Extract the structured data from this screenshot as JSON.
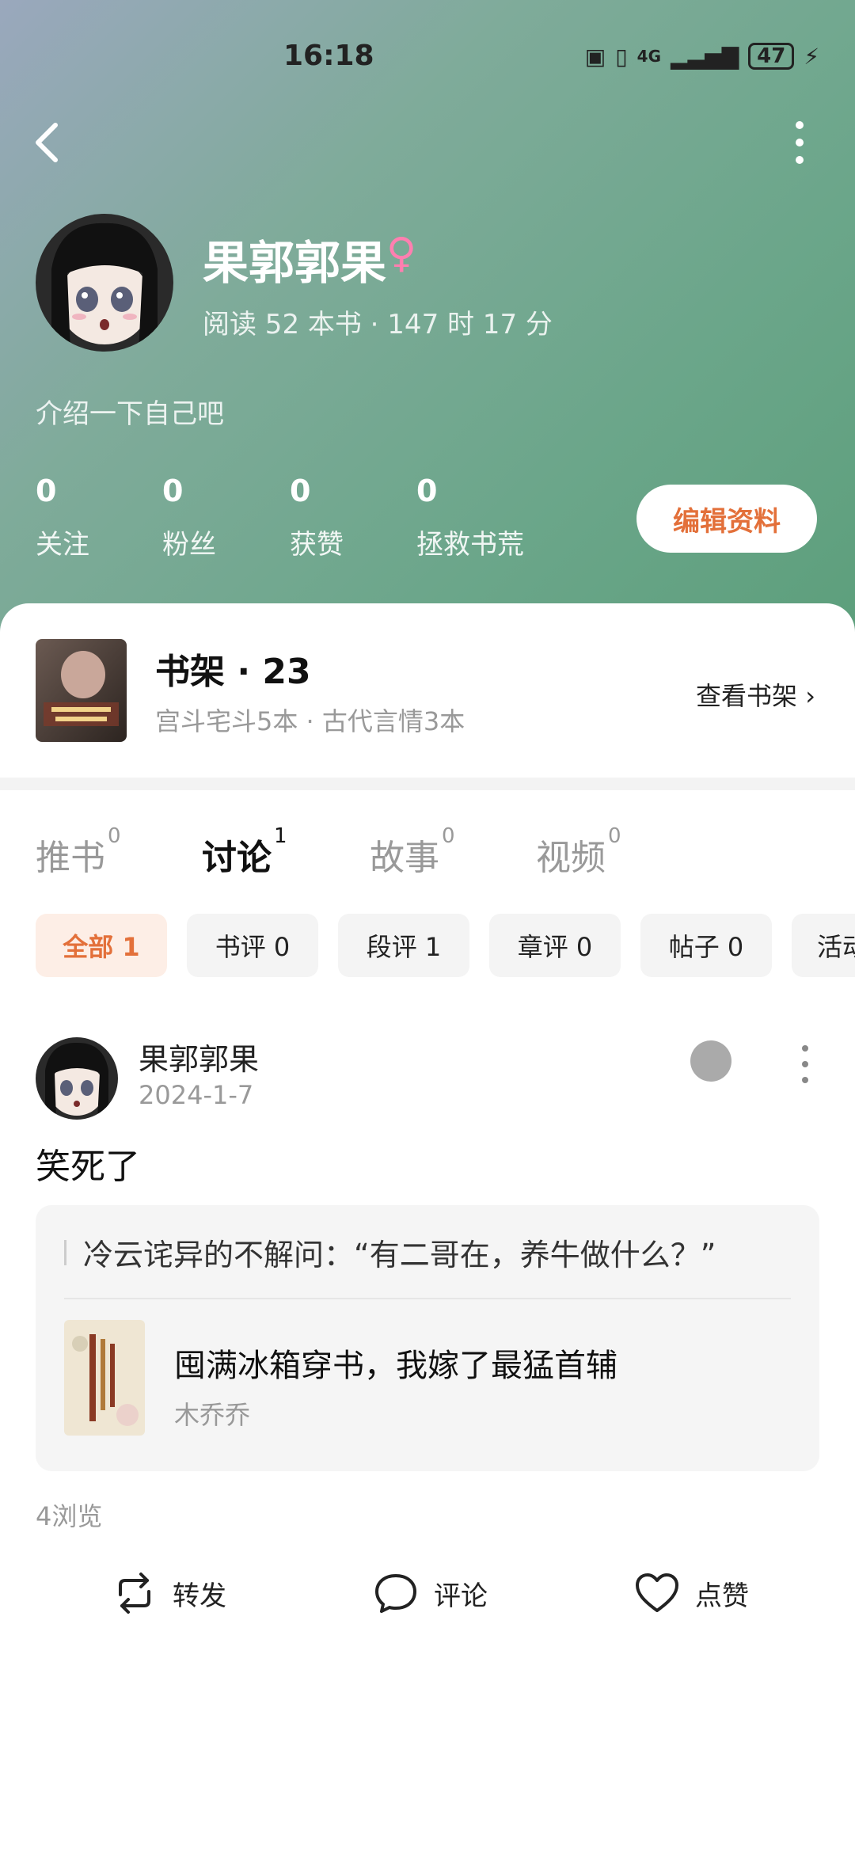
{
  "status_bar": {
    "time": "16:18",
    "network": "4G",
    "battery": "47"
  },
  "profile": {
    "name": "果郭郭果",
    "gender_symbol": "♀",
    "read_stat": "阅读 52 本书 · 147 时 17 分",
    "intro": "介绍一下自己吧",
    "stats": [
      {
        "value": "0",
        "label": "关注"
      },
      {
        "value": "0",
        "label": "粉丝"
      },
      {
        "value": "0",
        "label": "获赞"
      },
      {
        "value": "0",
        "label": "拯救书荒"
      }
    ],
    "edit_button": "编辑资料"
  },
  "shelf": {
    "title": "书架 · 23",
    "subtitle": "宫斗宅斗5本 · 古代言情3本",
    "link": "查看书架 ›"
  },
  "tabs": [
    {
      "label": "推书",
      "count": "0"
    },
    {
      "label": "讨论",
      "count": "1"
    },
    {
      "label": "故事",
      "count": "0"
    },
    {
      "label": "视频",
      "count": "0"
    }
  ],
  "chips": [
    "全部 1",
    "书评 0",
    "段评 1",
    "章评 0",
    "帖子 0",
    "活动"
  ],
  "post": {
    "author": "果郭郭果",
    "date": "2024-1-7",
    "text": "笑死了",
    "quote": "冷云诧异的不解问：“有二哥在，养牛做什么？”",
    "book_title": "囤满冰箱穿书，我嫁了最猛首辅",
    "book_author": "木乔乔",
    "views": "4浏览"
  },
  "actions": {
    "share": "转发",
    "comment": "评论",
    "like": "点赞"
  },
  "colors": {
    "accent": "#e3703a",
    "hero_green": "#6ba68a"
  }
}
